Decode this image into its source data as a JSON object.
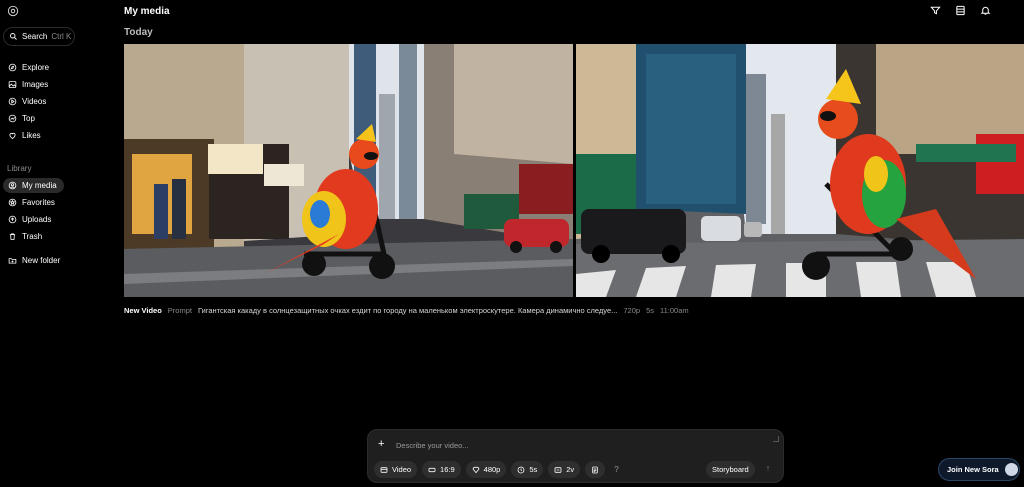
{
  "app": {
    "logo_icon": "openai-logo-icon"
  },
  "sidebar": {
    "search_label": "Search",
    "search_shortcut": "Ctrl K",
    "nav": [
      {
        "label": "Explore",
        "icon": "compass-icon"
      },
      {
        "label": "Images",
        "icon": "image-icon"
      },
      {
        "label": "Videos",
        "icon": "play-icon"
      },
      {
        "label": "Top",
        "icon": "trending-icon"
      },
      {
        "label": "Likes",
        "icon": "heart-icon"
      }
    ],
    "library_label": "Library",
    "library": [
      {
        "label": "My media",
        "icon": "person-icon",
        "active": true
      },
      {
        "label": "Favorites",
        "icon": "star-icon"
      },
      {
        "label": "Uploads",
        "icon": "upload-icon"
      },
      {
        "label": "Trash",
        "icon": "trash-icon"
      }
    ],
    "new_folder_label": "New folder"
  },
  "header": {
    "title": "My media",
    "icons": [
      "filter-icon",
      "layout-icon",
      "bell-icon"
    ]
  },
  "main": {
    "group_label": "Today",
    "video": {
      "name": "New Video",
      "prompt_label": "Prompt",
      "prompt_text": "Гигантская какаду в солнцезащитных очках ездит по городу на маленьком электроскутере. Камера динамично следуе...",
      "resolution": "720p",
      "duration": "5s",
      "time": "11:00am"
    }
  },
  "composer": {
    "placeholder": "Describe your video...",
    "chips": [
      {
        "label": "Video",
        "icon": "video-icon"
      },
      {
        "label": "16:9",
        "icon": "aspect-icon"
      },
      {
        "label": "480p",
        "icon": "diamond-icon"
      },
      {
        "label": "5s",
        "icon": "clock-icon"
      },
      {
        "label": "2v",
        "icon": "variations-icon"
      }
    ],
    "preset_icon": "preset-icon",
    "help": "?",
    "storyboard_label": "Storyboard"
  },
  "join": {
    "label": "Join New Sora"
  },
  "colors": {
    "background": "#000000",
    "chip": "#2e2e2e",
    "composer": "#1f1f1f",
    "accent_blue": "#0e1a2b"
  }
}
